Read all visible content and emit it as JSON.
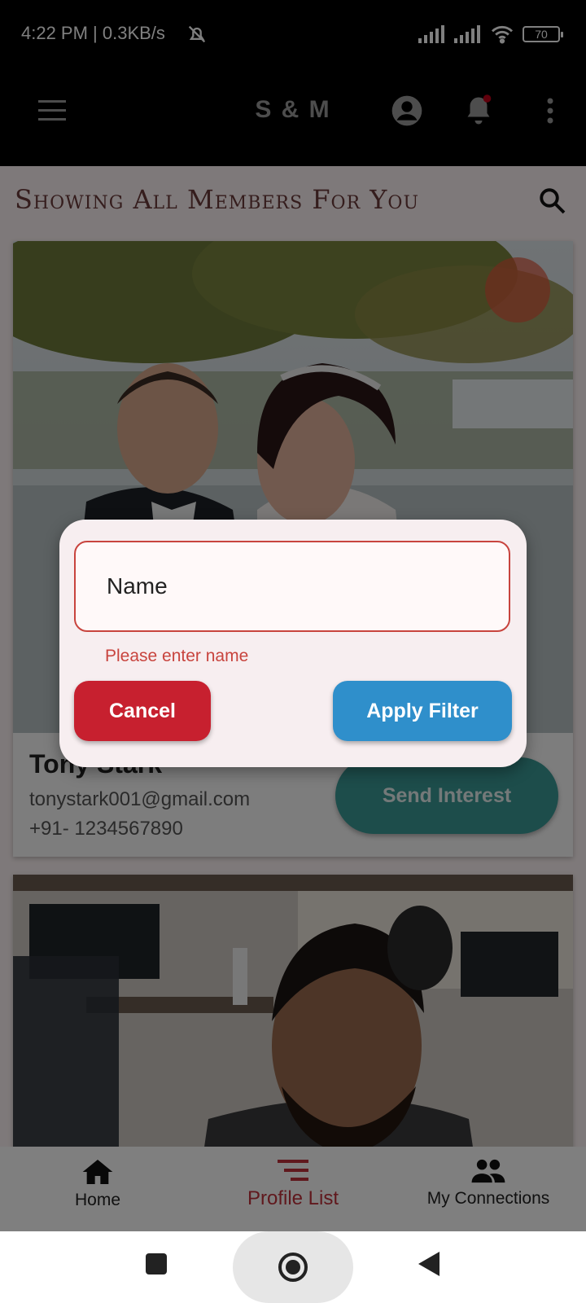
{
  "status_bar": {
    "time": "4:22 PM | 0.3KB/s",
    "battery": "70",
    "icons": [
      "alarm-off-icon",
      "signal-icon",
      "signal-icon",
      "wifi-icon",
      "battery-icon"
    ]
  },
  "app_bar": {
    "title": "S & M",
    "icons": [
      "menu-icon",
      "account-icon",
      "notification-bell-icon",
      "more-vert-icon"
    ]
  },
  "page": {
    "heading": "Showing All Members For You",
    "search_icon": "search-icon"
  },
  "profiles": [
    {
      "name": "Tony Stark",
      "email": "tonystark001@gmail.com",
      "phone": "+91- 1234567890",
      "action_label": "Send Interest"
    }
  ],
  "dialog": {
    "name_placeholder": "Name",
    "error": "Please enter name",
    "cancel_label": "Cancel",
    "apply_label": "Apply Filter"
  },
  "bottom_nav": {
    "items": [
      {
        "label": "Home",
        "icon": "home-icon"
      },
      {
        "label": "Profile List",
        "icon": "list-icon",
        "active": true
      },
      {
        "label": "My Connections",
        "icon": "people-icon"
      }
    ]
  },
  "system_nav": [
    "recents-icon",
    "home-circle-icon",
    "back-icon"
  ],
  "colors": {
    "accent_red": "#c7202f",
    "accent_blue": "#2f8fcb",
    "teal": "#3a9a97",
    "error": "#c8443e"
  }
}
